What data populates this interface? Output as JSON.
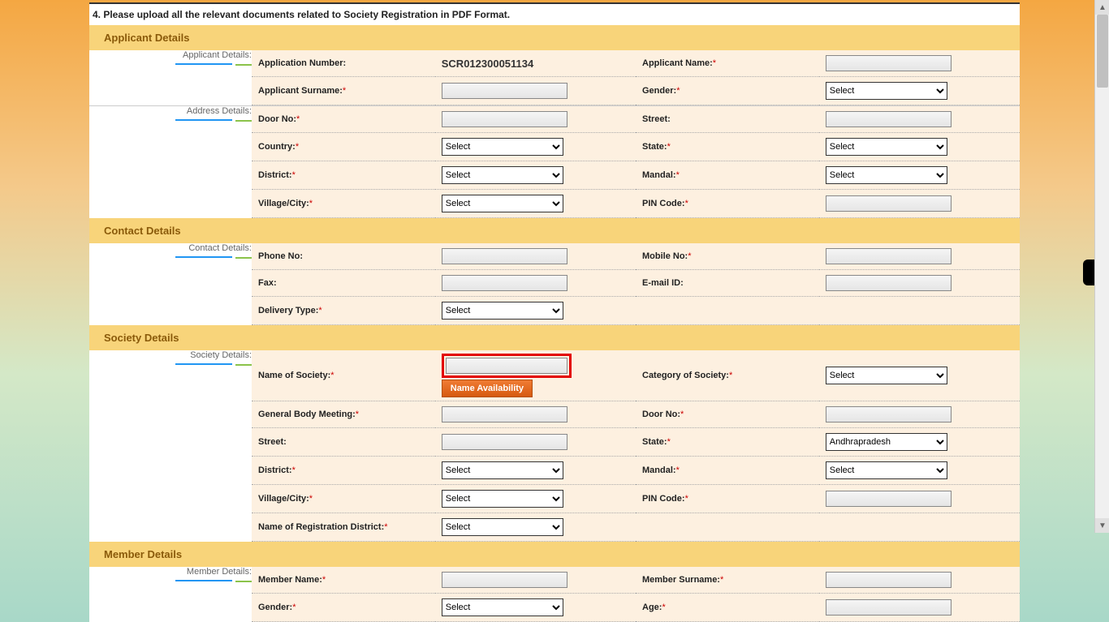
{
  "instruction": "4. Please upload all the relevant documents related to Society Registration in PDF Format.",
  "select_default": "Select",
  "sections": {
    "applicant": {
      "title": "Applicant Details",
      "sub1": "Applicant Details:",
      "sub2": "Address Details:",
      "app_num_label": "Application Number:",
      "app_num_value": "SCR012300051134",
      "applicant_name": "Applicant Name:",
      "surname": "Applicant Surname:",
      "gender": "Gender:",
      "door_no": "Door No:",
      "street": "Street:",
      "country": "Country:",
      "state": "State:",
      "district": "District:",
      "mandal": "Mandal:",
      "village": "Village/City:",
      "pin": "PIN Code:"
    },
    "contact": {
      "title": "Contact Details",
      "sub": "Contact Details:",
      "phone": "Phone No:",
      "mobile": "Mobile No:",
      "fax": "Fax:",
      "email": "E-mail ID:",
      "delivery": "Delivery Type:"
    },
    "society": {
      "title": "Society Details",
      "sub": "Society Details:",
      "name_of_society": "Name of  Society:",
      "name_avail": "Name Availability",
      "category": "Category of Society:",
      "gbm": "General Body Meeting:",
      "door_no": "Door No:",
      "street": "Street:",
      "state": "State:",
      "state_value": "Andhrapradesh",
      "district": "District:",
      "mandal": "Mandal:",
      "village": "Village/City:",
      "pin": "PIN Code:",
      "reg_district": "Name of Registration District:"
    },
    "member": {
      "title": "Member Details",
      "sub": "Member Details:",
      "name": "Member Name:",
      "surname": "Member Surname:",
      "gender": "Gender:",
      "age": "Age:"
    }
  },
  "asterisk": "*"
}
